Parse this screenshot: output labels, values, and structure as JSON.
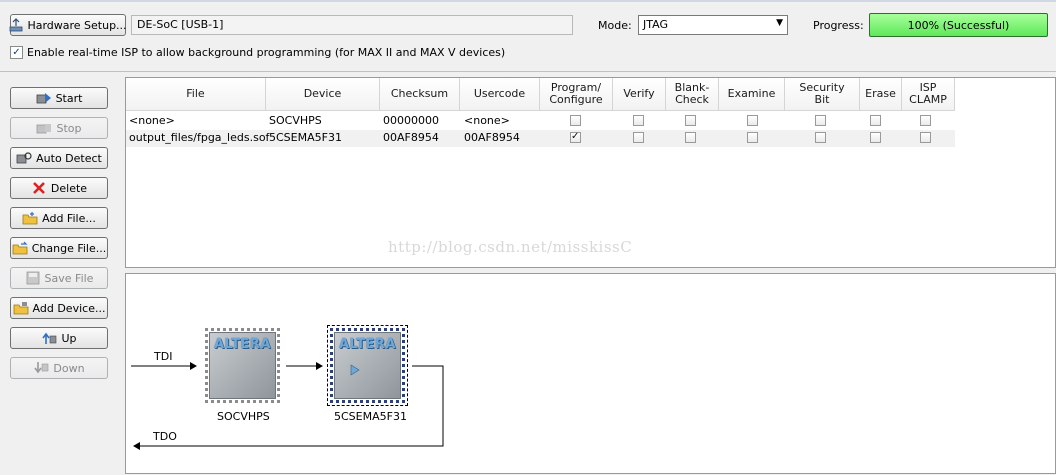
{
  "toolbar": {
    "hardware_setup_label": "Hardware Setup...",
    "hardware_value": "DE-SoC [USB-1]",
    "mode_label": "Mode:",
    "mode_value": "JTAG",
    "progress_label": "Progress:",
    "progress_text": "100% (Successful)",
    "progress_fraction": 1.0,
    "isp_checkbox_label": "Enable real-time ISP to allow background programming (for MAX II and MAX V devices)",
    "isp_checked": true
  },
  "sidebar": {
    "buttons": [
      {
        "label": "Start",
        "icon": "start-icon",
        "enabled": true
      },
      {
        "label": "Stop",
        "icon": "stop-icon",
        "enabled": false
      },
      {
        "label": "Auto Detect",
        "icon": "auto-detect-icon",
        "enabled": true
      },
      {
        "label": "Delete",
        "icon": "delete-x-icon",
        "enabled": true
      },
      {
        "label": "Add File...",
        "icon": "add-file-icon",
        "enabled": true
      },
      {
        "label": "Change File...",
        "icon": "change-file-icon",
        "enabled": true
      },
      {
        "label": "Save File",
        "icon": "save-file-icon",
        "enabled": false
      },
      {
        "label": "Add Device...",
        "icon": "add-device-icon",
        "enabled": true
      },
      {
        "label": "Up",
        "icon": "up-icon",
        "enabled": true
      },
      {
        "label": "Down",
        "icon": "down-icon",
        "enabled": false
      }
    ]
  },
  "table": {
    "columns": [
      "File",
      "Device",
      "Checksum",
      "Usercode",
      "Program/\nConfigure",
      "Verify",
      "Blank-\nCheck",
      "Examine",
      "Security\nBit",
      "Erase",
      "ISP\nCLAMP"
    ],
    "rows": [
      {
        "file": "<none>",
        "device": "SOCVHPS",
        "checksum": "00000000",
        "usercode": "<none>",
        "checks": [
          false,
          false,
          false,
          false,
          false,
          false,
          false
        ]
      },
      {
        "file": "output_files/fpga_leds.sof",
        "device": "5CSEMA5F31",
        "checksum": "00AF8954",
        "usercode": "00AF8954",
        "checks": [
          true,
          false,
          false,
          false,
          false,
          false,
          false
        ]
      }
    ],
    "watermark": "http://blog.csdn.net/misskissC"
  },
  "chain": {
    "tdi_label": "TDI",
    "tdo_label": "TDO",
    "devices": [
      {
        "name": "SOCVHPS",
        "logo": "ALTERA"
      },
      {
        "name": "5CSEMA5F31",
        "logo": "ALTERA"
      }
    ]
  },
  "colors": {
    "progress_green": "#5ee85a",
    "chip_logo_blue": "#6fa8d8"
  }
}
